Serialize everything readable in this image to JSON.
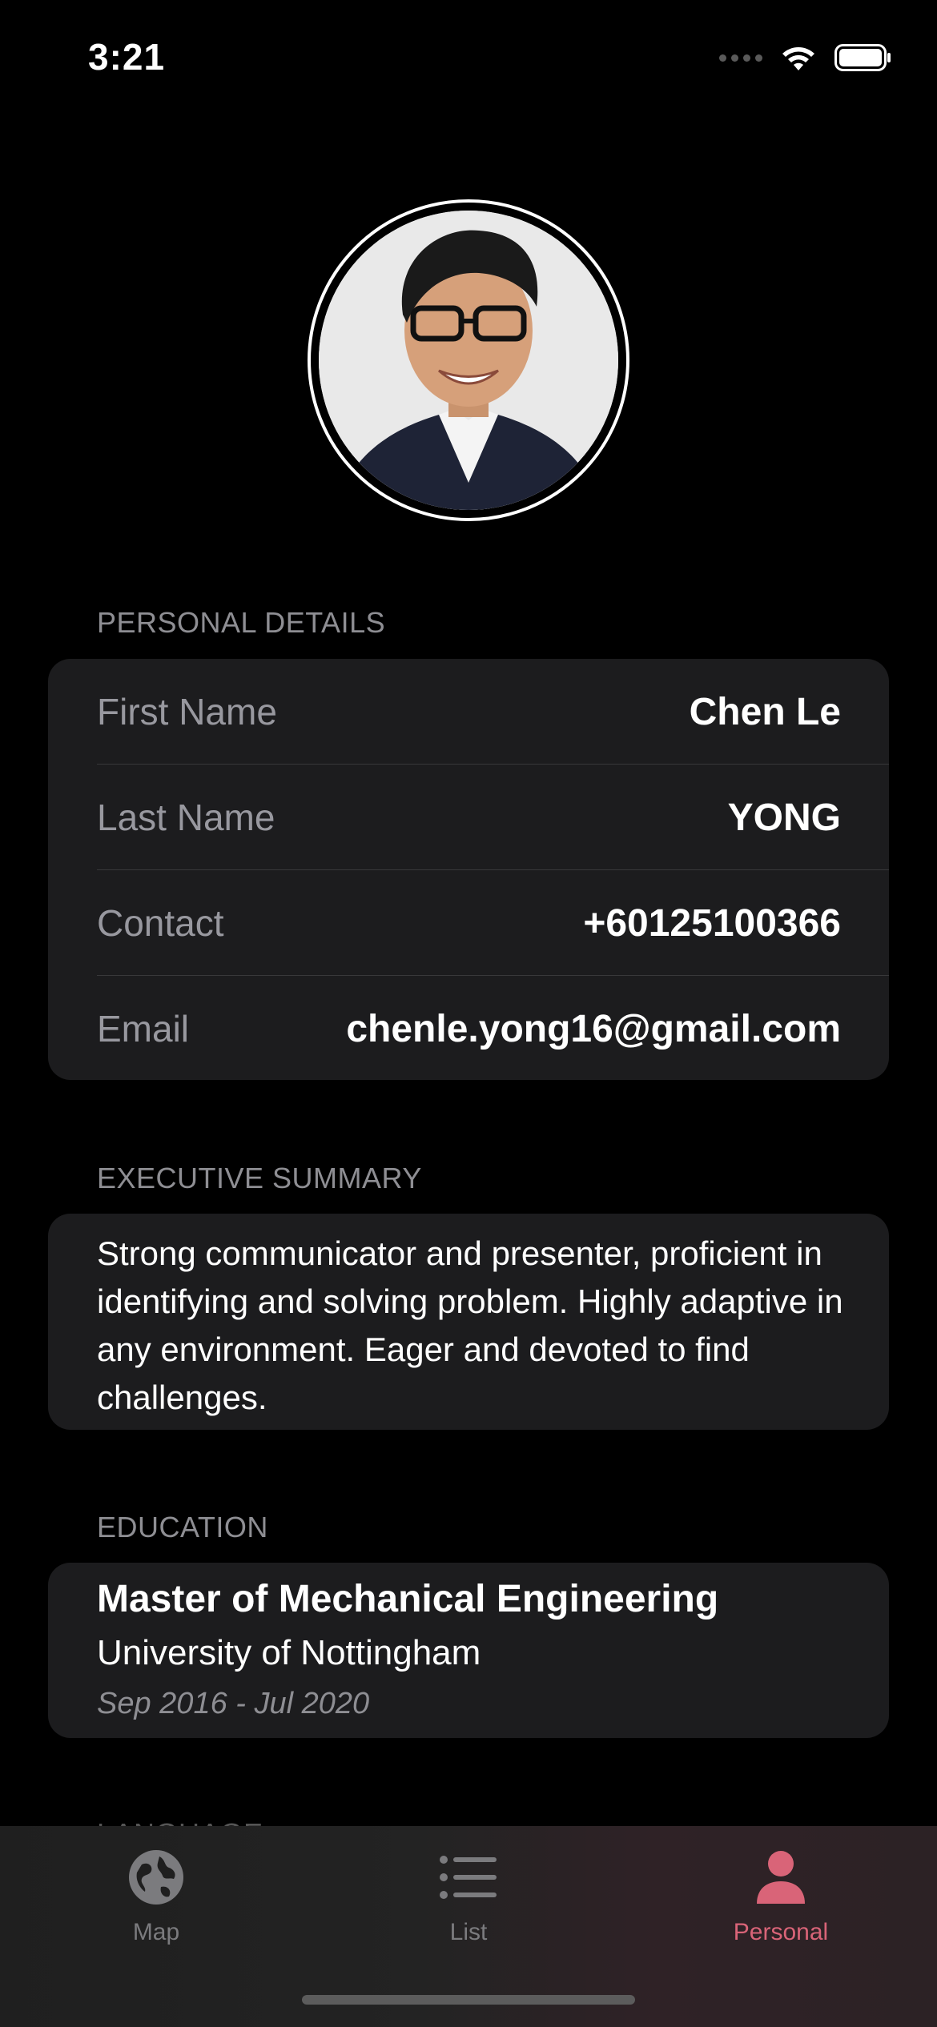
{
  "status_bar": {
    "time": "3:21"
  },
  "profile": {
    "avatar": "profile-photo"
  },
  "personal_details": {
    "header": "PERSONAL DETAILS",
    "rows": [
      {
        "label": "First Name",
        "value": "Chen Le"
      },
      {
        "label": "Last Name",
        "value": "YONG"
      },
      {
        "label": "Contact",
        "value": "+60125100366"
      },
      {
        "label": "Email",
        "value": "chenle.yong16@gmail.com"
      }
    ]
  },
  "executive_summary": {
    "header": "EXECUTIVE SUMMARY",
    "text": "Strong communicator and presenter, proficient in identifying and solving problem. Highly adaptive in any environment. Eager and devoted to find challenges."
  },
  "education": {
    "header": "EDUCATION",
    "degree": "Master of Mechanical Engineering",
    "school": "University of Nottingham",
    "dates": "Sep 2016 - Jul 2020"
  },
  "next_section_peek": "LANGUAGE",
  "tabbar": {
    "tabs": [
      {
        "label": "Map",
        "icon": "globe-icon"
      },
      {
        "label": "List",
        "icon": "list-icon"
      },
      {
        "label": "Personal",
        "icon": "person-icon"
      }
    ],
    "active": "Personal"
  },
  "colors": {
    "accent": "#d96478",
    "card": "#1c1c1e",
    "background": "#000000"
  }
}
